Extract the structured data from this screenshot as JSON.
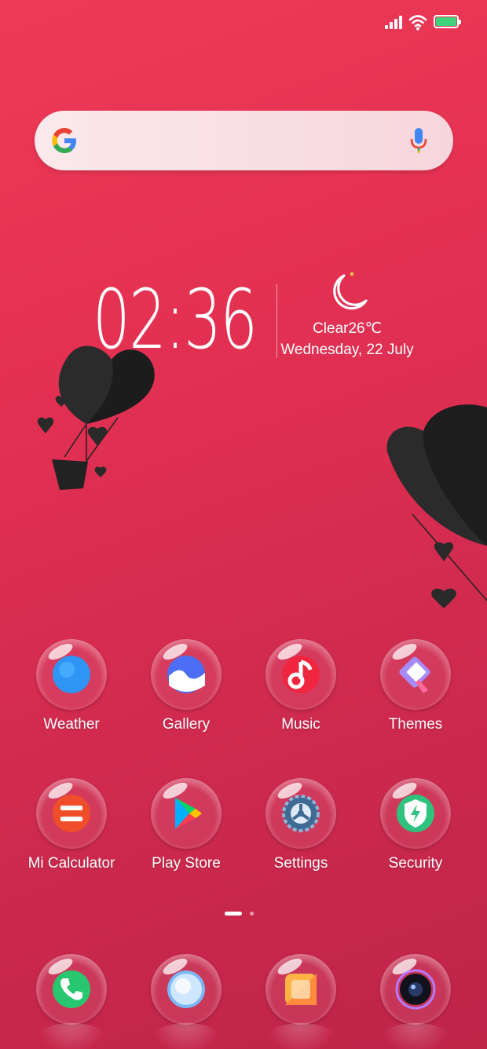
{
  "status_bar": {
    "signal_icon": "signal-icon",
    "wifi_icon": "wifi-icon",
    "battery_icon": "battery-icon",
    "battery_color": "#3ed47e"
  },
  "search": {
    "logo_icon": "google-g-icon",
    "mic_icon": "mic-icon",
    "placeholder": ""
  },
  "widget": {
    "time": "02:36",
    "weather": "Clear26℃",
    "date": "Wednesday, 22 July",
    "weather_icon": "moon-icon"
  },
  "apps": [
    {
      "label": "Weather",
      "icon": "weather-icon"
    },
    {
      "label": "Gallery",
      "icon": "gallery-icon"
    },
    {
      "label": "Music",
      "icon": "music-icon"
    },
    {
      "label": "Themes",
      "icon": "themes-icon"
    },
    {
      "label": "Mi Calculator",
      "icon": "calculator-icon"
    },
    {
      "label": "Play Store",
      "icon": "play-store-icon"
    },
    {
      "label": "Settings",
      "icon": "settings-icon"
    },
    {
      "label": "Security",
      "icon": "security-icon"
    }
  ],
  "page_indicator": {
    "pages": 2,
    "current": 1
  },
  "dock": [
    {
      "icon": "phone-icon"
    },
    {
      "icon": "messaging-icon"
    },
    {
      "icon": "browser-icon"
    },
    {
      "icon": "camera-icon"
    }
  ],
  "colors": {
    "background_top": "#ef3a57",
    "background_bottom": "#bf2449"
  }
}
